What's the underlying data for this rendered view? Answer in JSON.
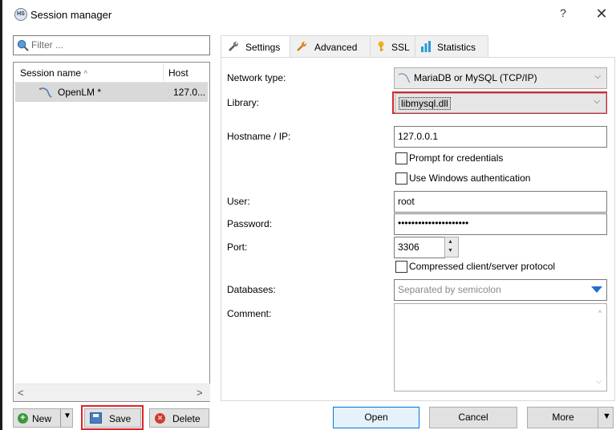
{
  "window": {
    "title": "Session manager",
    "help_label": "?",
    "close_label": "✕",
    "icon_text": "HS"
  },
  "left_panel": {
    "filter_placeholder": "Filter ...",
    "columns": {
      "name": "Session name",
      "sort_glyph": "^",
      "host": "Host"
    },
    "sessions": [
      {
        "name": "OpenLM *",
        "host": "127.0..."
      }
    ],
    "scroll_left": "<",
    "scroll_right": ">"
  },
  "left_buttons": {
    "new": "New",
    "save": "Save",
    "delete": "Delete"
  },
  "tabs": [
    {
      "label": "Settings",
      "active": true
    },
    {
      "label": "Advanced",
      "active": false
    },
    {
      "label": "SSL",
      "active": false
    },
    {
      "label": "Statistics",
      "active": false
    }
  ],
  "settings": {
    "network_type_label": "Network type:",
    "network_type_value": "MariaDB or MySQL (TCP/IP)",
    "library_label": "Library:",
    "library_value": "libmysql.dll",
    "hostname_label": "Hostname / IP:",
    "hostname_value": "127.0.0.1",
    "prompt_credentials": "Prompt for credentials",
    "windows_auth": "Use Windows authentication",
    "user_label": "User:",
    "user_value": "root",
    "password_label": "Password:",
    "password_value": "•••••••••••••••••••••",
    "port_label": "Port:",
    "port_value": "3306",
    "compressed": "Compressed client/server protocol",
    "databases_label": "Databases:",
    "databases_placeholder": "Separated by semicolon",
    "comment_label": "Comment:"
  },
  "bottom_buttons": {
    "open": "Open",
    "cancel": "Cancel",
    "more": "More"
  },
  "colors": {
    "highlight_border": "#d9262b",
    "selected_row": "#d9d9d9",
    "dropdown_arrow": "#1f6fd0"
  }
}
